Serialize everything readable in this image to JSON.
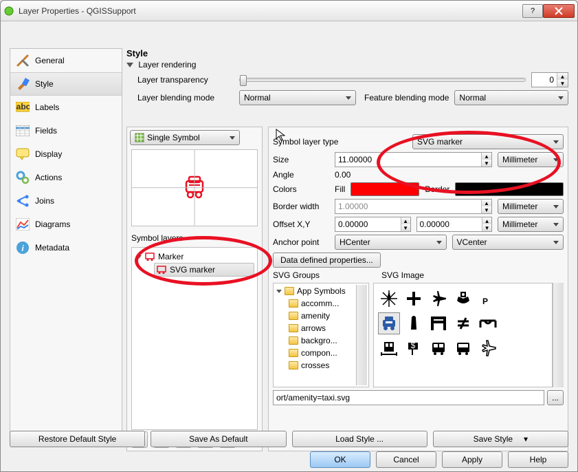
{
  "window": {
    "title": "Layer Properties - QGISSupport"
  },
  "sidebar": {
    "items": [
      {
        "label": "General"
      },
      {
        "label": "Style"
      },
      {
        "label": "Labels"
      },
      {
        "label": "Fields"
      },
      {
        "label": "Display"
      },
      {
        "label": "Actions"
      },
      {
        "label": "Joins"
      },
      {
        "label": "Diagrams"
      },
      {
        "label": "Metadata"
      }
    ]
  },
  "style": {
    "heading": "Style",
    "rendering_section": "Layer rendering",
    "transparency_label": "Layer transparency",
    "transparency_value": "0",
    "layer_blend_label": "Layer blending mode",
    "layer_blend_value": "Normal",
    "feature_blend_label": "Feature blending mode",
    "feature_blend_value": "Normal",
    "renderer_combo": "Single Symbol",
    "symbol_layers_label": "Symbol layers",
    "tree_root": "Marker",
    "tree_child": "SVG marker"
  },
  "symbolopts": {
    "type_label": "Symbol layer type",
    "type_value": "SVG marker",
    "size_label": "Size",
    "size_value": "11.00000",
    "size_unit": "Millimeter",
    "angle_label": "Angle",
    "angle_value": "0.00",
    "colors_label": "Colors",
    "fill_label": "Fill",
    "fill_color": "#ff0000",
    "border_label": "Border",
    "border_color": "#000000",
    "bwidth_label": "Border width",
    "bwidth_value": "1.00000",
    "bwidth_unit": "Millimeter",
    "offset_label": "Offset X,Y",
    "offset_x": "0.00000",
    "offset_y": "0.00000",
    "offset_unit": "Millimeter",
    "anchor_label": "Anchor point",
    "anchor_h": "HCenter",
    "anchor_v": "VCenter",
    "ddp_button": "Data defined properties...",
    "svg_groups_label": "SVG Groups",
    "svg_image_label": "SVG Image",
    "svg_groups": [
      "App Symbols",
      "accomm...",
      "amenity",
      "arrows",
      "backgro...",
      "compon...",
      "crosses"
    ],
    "path_value": "ort/amenity=taxi.svg"
  },
  "bottom": {
    "restore": "Restore Default Style",
    "saveas": "Save As Default",
    "load": "Load Style ...",
    "save": "Save Style"
  },
  "dialog": {
    "ok": "OK",
    "cancel": "Cancel",
    "apply": "Apply",
    "help": "Help"
  }
}
